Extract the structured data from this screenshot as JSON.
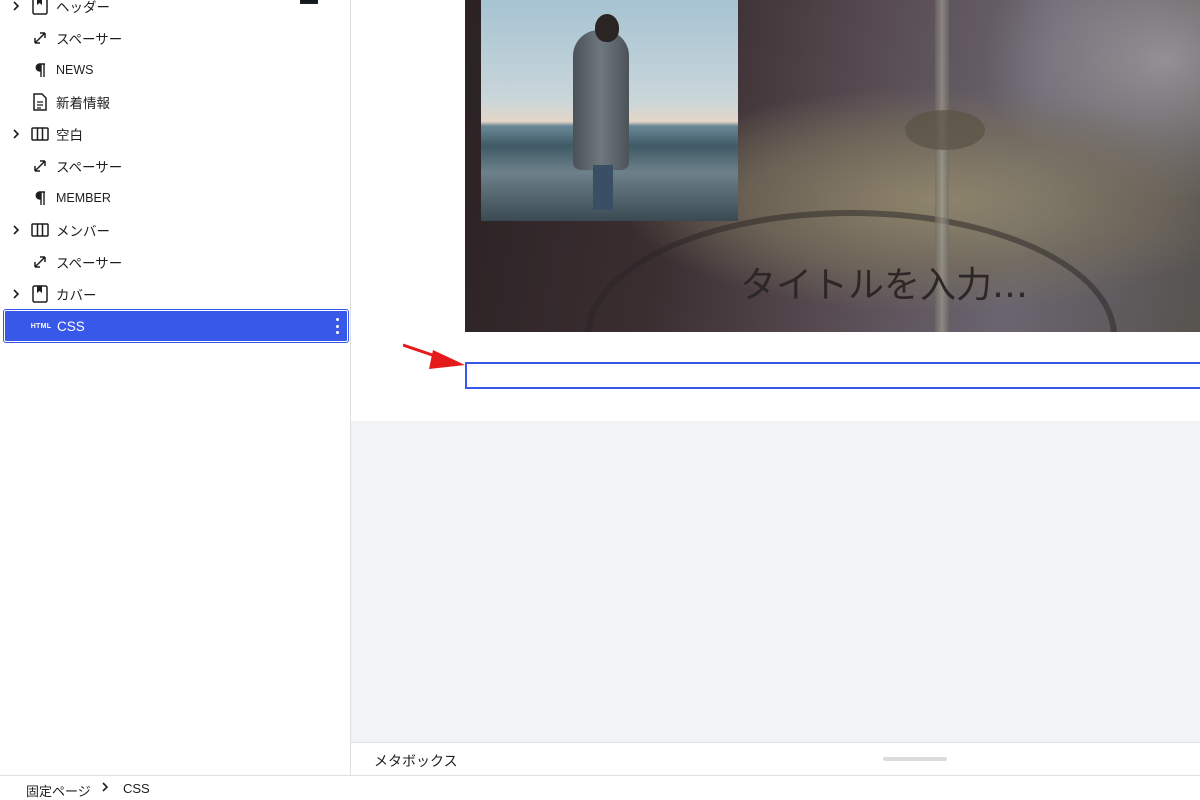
{
  "list_view": {
    "items": [
      {
        "label": "ヘッダー",
        "icon": "bookmark-icon",
        "expandable": true
      },
      {
        "label": "スペーサー",
        "icon": "resize-arrow-icon",
        "expandable": false
      },
      {
        "label": "NEWS",
        "icon": "paragraph-icon",
        "expandable": false
      },
      {
        "label": "新着情報",
        "icon": "document-icon",
        "expandable": false
      },
      {
        "label": "空白",
        "icon": "columns-icon",
        "expandable": true
      },
      {
        "label": "スペーサー",
        "icon": "resize-arrow-icon",
        "expandable": false
      },
      {
        "label": "MEMBER",
        "icon": "paragraph-icon",
        "expandable": false
      },
      {
        "label": "メンバー",
        "icon": "columns-icon",
        "expandable": true
      },
      {
        "label": "スペーサー",
        "icon": "resize-arrow-icon",
        "expandable": false
      },
      {
        "label": "カバー",
        "icon": "bookmark-icon",
        "expandable": true
      },
      {
        "label": "CSS",
        "icon": "html-icon",
        "icon_text": "HTML",
        "expandable": false,
        "selected": true
      }
    ]
  },
  "canvas": {
    "cover_title_placeholder": "タイトルを入力…"
  },
  "metabox": {
    "label": "メタボックス"
  },
  "breadcrumb": {
    "items": [
      "固定ページ",
      "CSS"
    ]
  },
  "colors": {
    "accent": "#3858e9",
    "arrow": "#e51b1b",
    "canvas_bg": "#f2f3f5"
  }
}
